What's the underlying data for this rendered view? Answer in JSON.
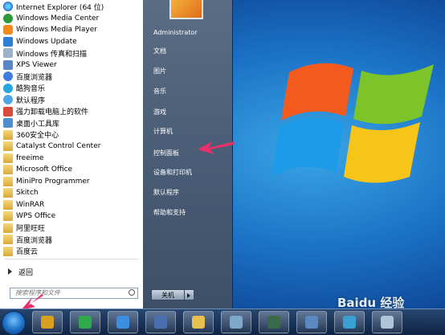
{
  "start_menu": {
    "programs": [
      {
        "label": "Internet Explorer (64 位)",
        "icon": "ie-icon"
      },
      {
        "label": "Windows Media Center",
        "icon": "media-center-icon"
      },
      {
        "label": "Windows Media Player",
        "icon": "media-player-icon"
      },
      {
        "label": "Windows Update",
        "icon": "windows-update-icon"
      },
      {
        "label": "Windows 传真和扫描",
        "icon": "fax-scan-icon"
      },
      {
        "label": "XPS Viewer",
        "icon": "xps-viewer-icon"
      },
      {
        "label": "百度浏览器",
        "icon": "baidu-browser-icon"
      },
      {
        "label": "酷狗音乐",
        "icon": "kugou-music-icon"
      },
      {
        "label": "默认程序",
        "icon": "default-programs-icon"
      },
      {
        "label": "强力卸载电脑上的软件",
        "icon": "uninstall-icon"
      },
      {
        "label": "桌面小工具库",
        "icon": "gadgets-icon"
      },
      {
        "label": "360安全中心",
        "icon": "folder-icon"
      },
      {
        "label": "Catalyst Control Center",
        "icon": "folder-icon"
      },
      {
        "label": "freeime",
        "icon": "folder-icon"
      },
      {
        "label": "Microsoft Office",
        "icon": "folder-icon"
      },
      {
        "label": "MiniPro Programmer",
        "icon": "folder-icon"
      },
      {
        "label": "Skitch",
        "icon": "folder-icon"
      },
      {
        "label": "WinRAR",
        "icon": "folder-icon"
      },
      {
        "label": "WPS Office",
        "icon": "folder-icon"
      },
      {
        "label": "阿里旺旺",
        "icon": "folder-icon"
      },
      {
        "label": "百度浏览器",
        "icon": "folder-icon"
      },
      {
        "label": "百度云",
        "icon": "folder-icon"
      }
    ],
    "back_label": "返回",
    "search_placeholder": "搜索程序和文件",
    "right_links": [
      {
        "label": "Administrator"
      },
      {
        "label": "文档"
      },
      {
        "label": "图片"
      },
      {
        "label": "音乐"
      },
      {
        "label": "游戏"
      },
      {
        "label": "计算机"
      },
      {
        "label": "控制面板"
      },
      {
        "label": "设备和打印机"
      },
      {
        "label": "默认程序"
      },
      {
        "label": "帮助和支持"
      }
    ],
    "shutdown_label": "关机"
  },
  "watermark_text": "Baidu 经验",
  "colors": {
    "accent_arrow": "#e8306a",
    "desktop_blue": "#1a6fc4"
  }
}
